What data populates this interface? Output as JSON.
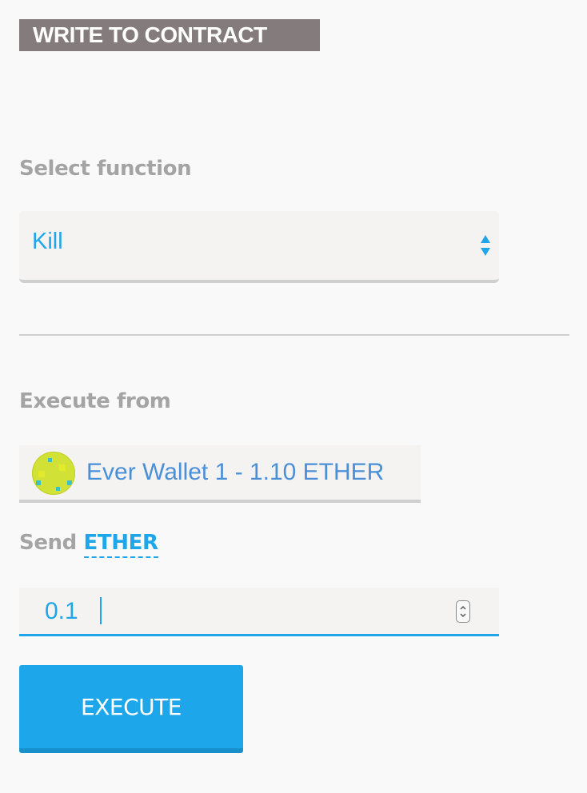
{
  "header": {
    "title": "WRITE TO CONTRACT"
  },
  "function_select": {
    "label": "Select function",
    "selected": "Kill"
  },
  "execute_from": {
    "label": "Execute from",
    "account": "Ever Wallet 1 - 1.10 ETHER"
  },
  "send": {
    "label": "Send",
    "unit": "ETHER",
    "value": "0.1"
  },
  "actions": {
    "execute_label": "EXECUTE"
  },
  "colors": {
    "accent": "#1ea6ea",
    "title_bg": "#847c7c",
    "label": "#a4a4a4",
    "account_text": "#4a90d9"
  }
}
